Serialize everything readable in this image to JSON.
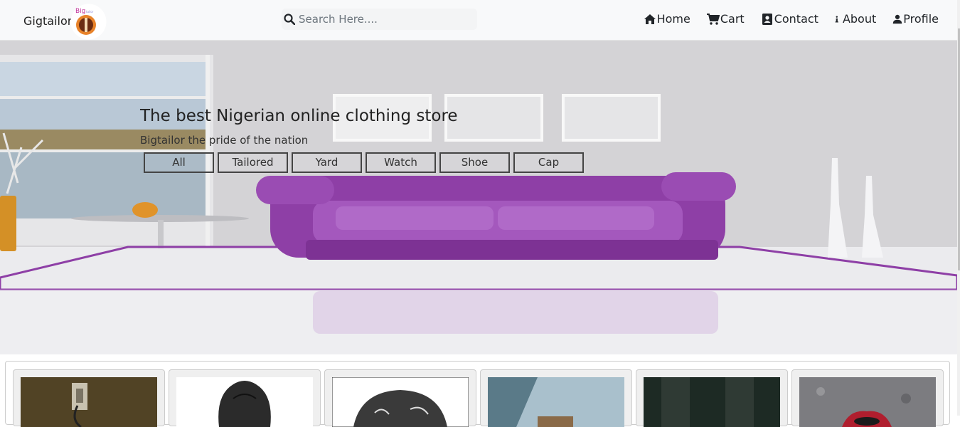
{
  "brand": {
    "name": "Gigtailor",
    "logo_text": "Big"
  },
  "search": {
    "placeholder": "Search Here...."
  },
  "nav": [
    {
      "label": "Home",
      "icon": "home-icon"
    },
    {
      "label": "Cart",
      "icon": "cart-icon"
    },
    {
      "label": "Contact",
      "icon": "contact-icon"
    },
    {
      "label": "About",
      "icon": "info-icon"
    },
    {
      "label": "Profile",
      "icon": "user-icon"
    }
  ],
  "hero": {
    "title": "The best Nigerian online clothing store",
    "subtitle": "Bigtailor the pride of the nation",
    "filters": [
      "All",
      "Tailored",
      "Yard",
      "Watch",
      "Shoe",
      "Cap"
    ]
  },
  "colors": {
    "sofa": "#8e3fa6",
    "navbar_bg": "#f8f9fa"
  }
}
